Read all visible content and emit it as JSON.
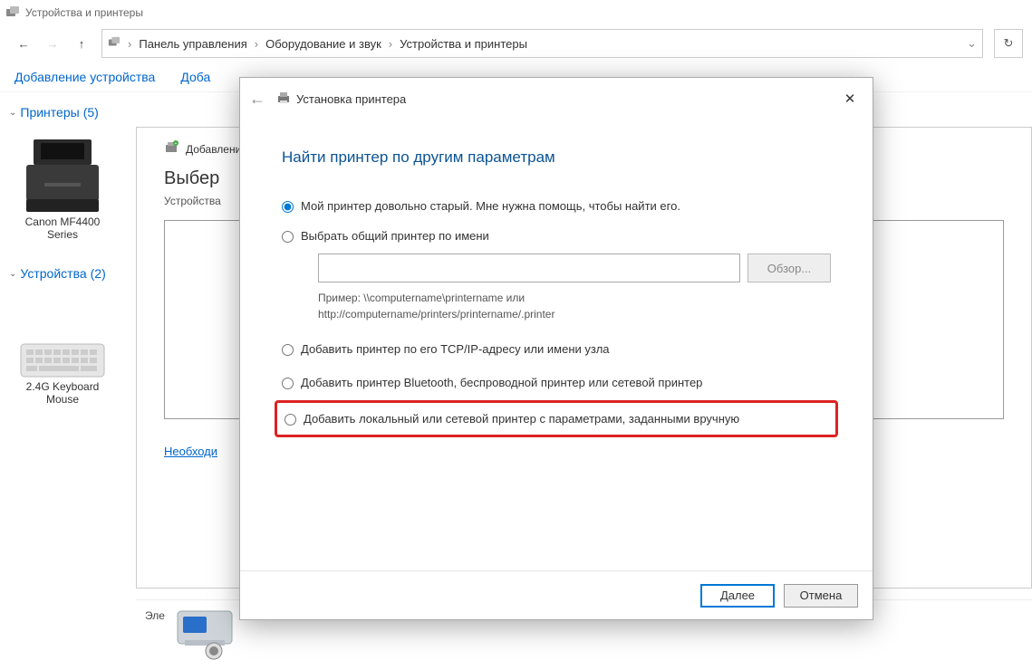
{
  "window": {
    "title": "Устройства и принтеры"
  },
  "breadcrumb": {
    "items": [
      "Панель управления",
      "Оборудование и звук",
      "Устройства и принтеры"
    ]
  },
  "toolbar": {
    "add_device": "Добавление устройства",
    "add_printer_partial": "Доба"
  },
  "categories": {
    "printers": {
      "label": "Принтеры",
      "count": "(5)"
    },
    "devices": {
      "label": "Устройства",
      "count": "(2)"
    }
  },
  "deviceItems": {
    "printer1_line1": "Canon MF4400",
    "printer1_line2": "Series",
    "kb_line1": "2.4G Keyboard",
    "kb_line2": "Mouse"
  },
  "innerPanel": {
    "header_label": "Добавление",
    "title": "Выбер",
    "subtitle": "Устройства",
    "link": "Необходи"
  },
  "statusbar": {
    "elements_label": "Эле"
  },
  "wizard": {
    "titlebar": "Установка принтера",
    "heading": "Найти принтер по другим параметрам",
    "opt1": "Мой принтер довольно старый. Мне нужна помощь, чтобы найти его.",
    "opt2": "Выбрать общий принтер по имени",
    "browse": "Обзор...",
    "example_l1": "Пример: \\\\computername\\printername или",
    "example_l2": "http://computername/printers/printername/.printer",
    "opt3": "Добавить принтер по его TCP/IP-адресу или имени узла",
    "opt4": "Добавить принтер Bluetooth, беспроводной принтер или сетевой принтер",
    "opt5": "Добавить локальный или сетевой принтер с параметрами, заданными вручную",
    "next": "Далее",
    "cancel": "Отмена"
  }
}
